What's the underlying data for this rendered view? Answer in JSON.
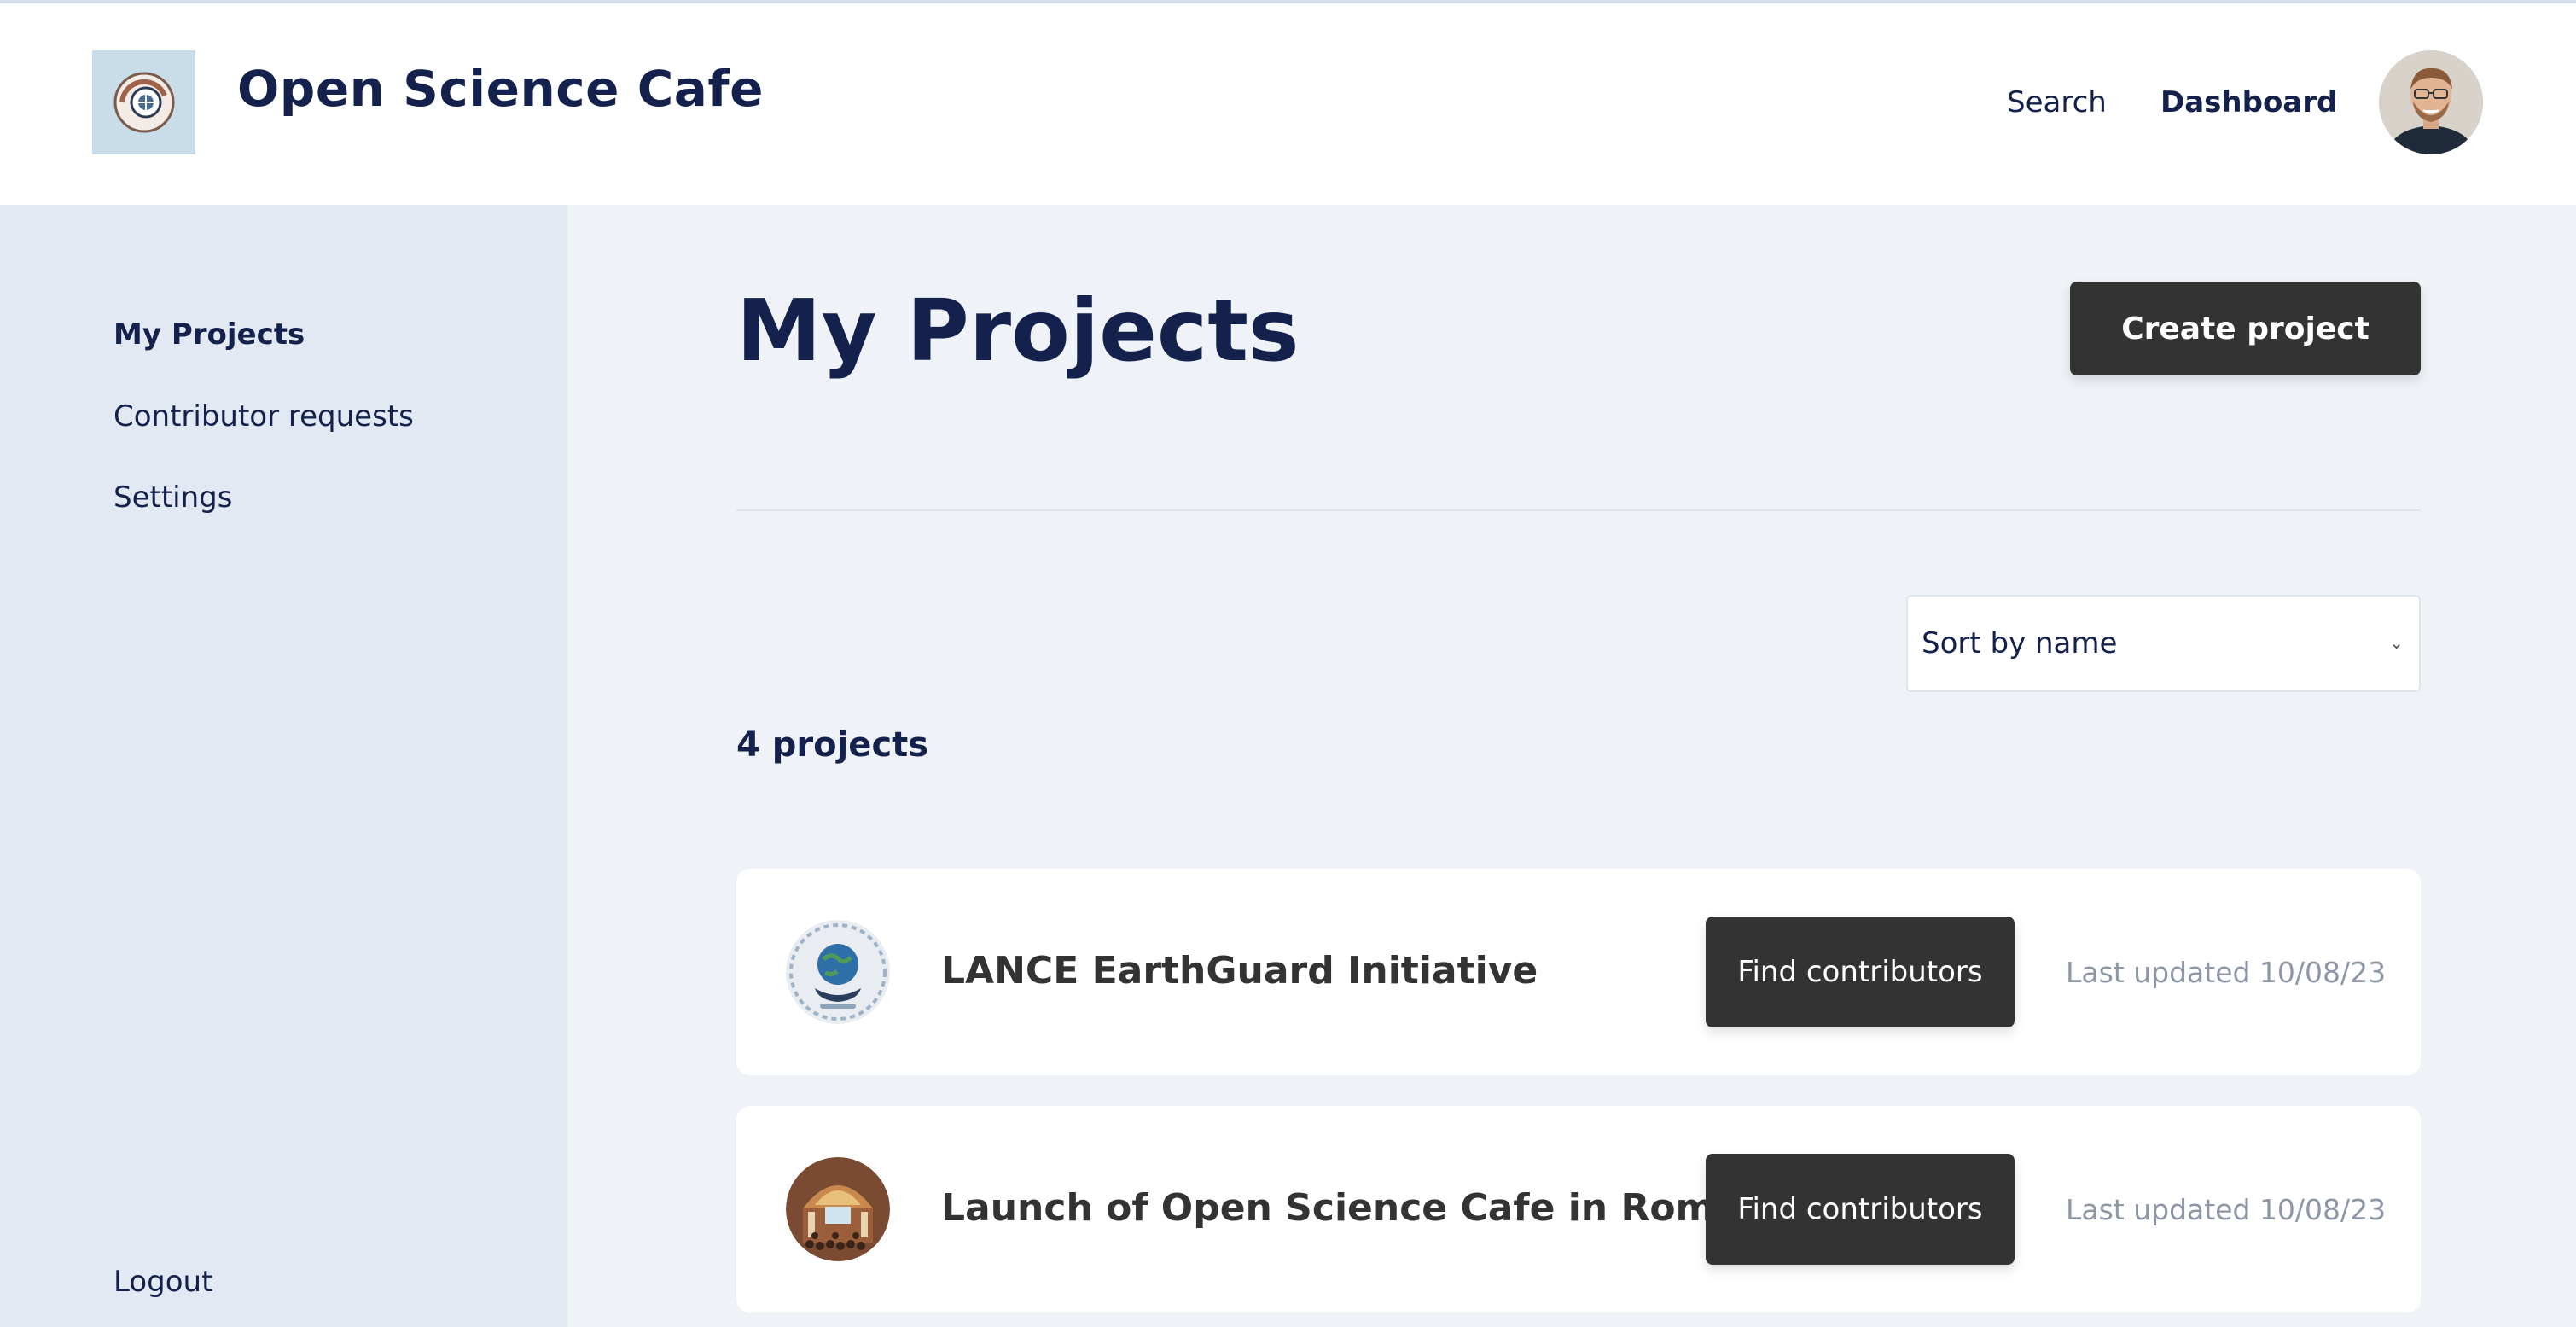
{
  "header": {
    "brand": "Open Science Cafe",
    "nav": {
      "search": "Search",
      "dashboard": "Dashboard"
    }
  },
  "sidebar": {
    "items": [
      {
        "label": "My Projects",
        "active": true
      },
      {
        "label": "Contributor requests",
        "active": false
      },
      {
        "label": "Settings",
        "active": false
      }
    ],
    "logout": "Logout"
  },
  "main": {
    "title": "My Projects",
    "create_button": "Create project",
    "sort": {
      "selected": "Sort by name"
    },
    "count": "4 projects",
    "projects": [
      {
        "name": "LANCE EarthGuard Initiative",
        "action": "Find contributors",
        "updated": "Last updated 10/08/23",
        "thumb_icon": "globe-icon"
      },
      {
        "name": "Launch of Open Science Cafe in Rome",
        "action": "Find contributors",
        "updated": "Last updated 10/08/23",
        "thumb_icon": "event-hall-icon"
      }
    ]
  },
  "colors": {
    "primary_text": "#14214d",
    "button_dark": "#333333",
    "page_bg": "#eff3f8",
    "sidebar_bg": "#e2e9f2",
    "muted_text": "#8e97a6"
  }
}
